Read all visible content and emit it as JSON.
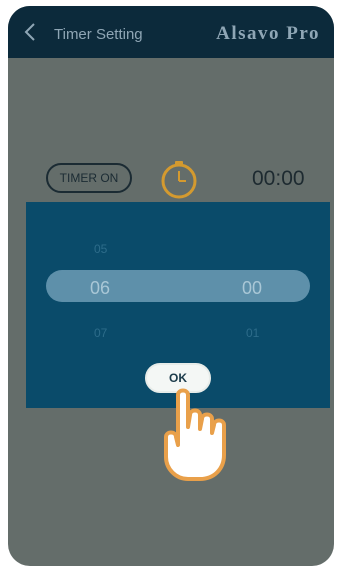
{
  "header": {
    "title": "Timer Setting",
    "brand": "Alsavo Pro",
    "back_icon": "chevron-left-icon"
  },
  "timer": {
    "toggle_label": "TIMER ON",
    "clock_icon": "clock-icon",
    "time": "00:00"
  },
  "picker": {
    "hours": {
      "prev": "05",
      "selected": "06",
      "next": "07"
    },
    "minutes": {
      "prev": "",
      "selected": "00",
      "next": "01"
    },
    "ok_label": "OK"
  },
  "overlay": {
    "hand_icon": "pointing-hand-icon"
  },
  "colors": {
    "header_bg": "#0c2a3b",
    "dim_bg": "#646d6a",
    "picker_bg": "#0a4b6a",
    "highlight": "#5e90aa",
    "accent_orange": "#e9a04a"
  }
}
